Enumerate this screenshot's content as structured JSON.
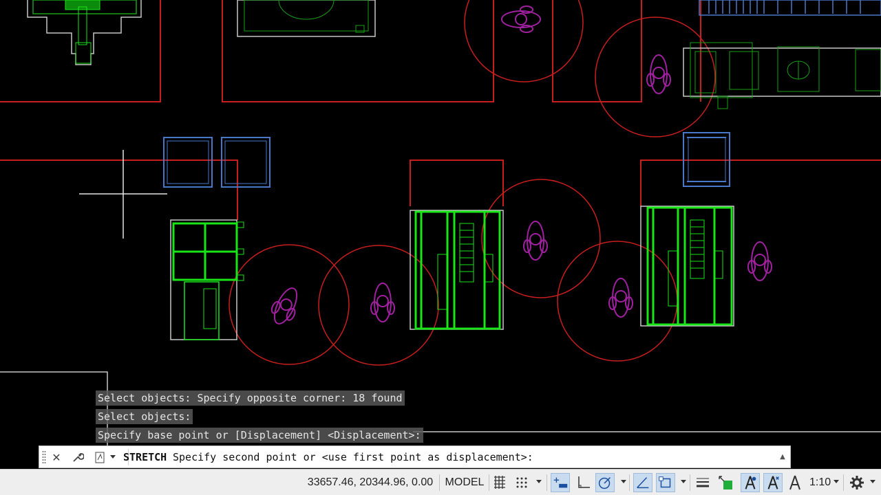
{
  "command_history": [
    "Select objects: Specify opposite corner: 18 found",
    "Select objects:",
    "Specify base point or [Displacement] <Displacement>:"
  ],
  "command_line": {
    "command": "STRETCH",
    "prompt": "Specify second point or <use first point as displacement>:"
  },
  "status_bar": {
    "coordinates": "33657.46, 20344.96, 0.00",
    "space": "MODEL",
    "annotation_scale": "1:10"
  },
  "colors": {
    "background": "#000000",
    "walls": "#c81e1e",
    "furniture": "#19e619",
    "people": "#a020a0",
    "blue_objects": "#4a78c8",
    "outline_gray": "#c8c8c8",
    "status_bar": "#eeeeee",
    "toggle_on": "#c9dbee"
  },
  "status_icons": [
    "grid-icon",
    "snap-icon",
    "ortho-icon",
    "polar-tracking-icon",
    "isodraft-icon",
    "object-snap-tracking-icon",
    "object-snap-icon",
    "lineweight-icon",
    "selection-cycling-icon",
    "annotation-visibility-icon",
    "auto-scale-icon",
    "annotation-scale-icon",
    "workspace-gear-icon"
  ]
}
